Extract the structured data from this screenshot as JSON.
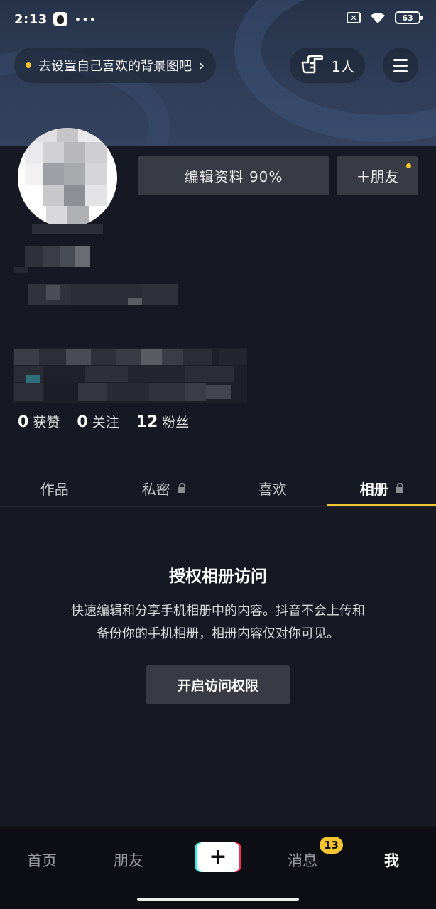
{
  "status_bar": {
    "time": "2:13",
    "dots": "•••",
    "sim_icon": "sim-off-icon",
    "battery": "63"
  },
  "header": {
    "background_hint": "去设置自己喜欢的背景图吧",
    "background_hint_chevron": "›",
    "visitors": "1人",
    "menu_icon": "hamburger-menu-icon"
  },
  "profile": {
    "edit_profile": "编辑资料 90%",
    "add_friend": "＋朋友",
    "stats": {
      "likes_count": "0",
      "likes_label": "获赞",
      "following_count": "0",
      "following_label": "关注",
      "followers_count": "12",
      "followers_label": "粉丝"
    }
  },
  "tabs": [
    {
      "label": "作品",
      "locked": false,
      "active": false
    },
    {
      "label": "私密",
      "locked": true,
      "active": false
    },
    {
      "label": "喜欢",
      "locked": false,
      "active": false
    },
    {
      "label": "相册",
      "locked": true,
      "active": true
    }
  ],
  "album": {
    "title": "授权相册访问",
    "description_line1": "快速编辑和分享手机相册中的内容。抖音不会上传和",
    "description_line2": "备份你的手机相册，相册内容仅对你可见。",
    "button": "开启访问权限"
  },
  "bottom_nav": {
    "home": "首页",
    "friends": "朋友",
    "create": "+",
    "messages": "消息",
    "messages_badge": "13",
    "me": "我"
  },
  "colors": {
    "accent": "#f7c531",
    "background": "#161823",
    "button_bg": "#393b44"
  }
}
